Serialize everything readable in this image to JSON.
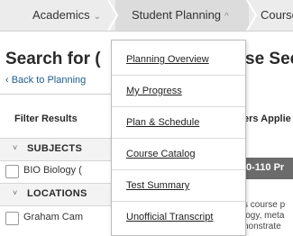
{
  "nav": {
    "tabs": [
      {
        "label": "Academics",
        "chevron": "⌄"
      },
      {
        "label": "Student Planning",
        "chevron": "^"
      },
      {
        "label": "Course"
      }
    ]
  },
  "page": {
    "heading_left": "Search for (",
    "heading_right": "se Sect",
    "back_link": "‹ Back to Planning"
  },
  "filters": {
    "title": "Filter Results",
    "sections": [
      {
        "label": "SUBJECTS",
        "caret": "˅",
        "items": [
          "BIO Biology ("
        ]
      },
      {
        "label": "LOCATIONS",
        "caret": "˅",
        "items": [
          "Graham Cam"
        ]
      }
    ]
  },
  "results": {
    "filters_applied": "ers Applie",
    "course_title": "0-110 Pr",
    "course_desc": [
      "s course p",
      "logy, meta",
      "nonstrate"
    ]
  },
  "menu": {
    "items": [
      "Planning Overview",
      "My Progress",
      "Plan & Schedule",
      "Course Catalog",
      "Test Summary",
      "Unofficial Transcript"
    ]
  },
  "colors": {
    "nav_bg": "#ececec",
    "active_tab": "#dcdcdc",
    "link": "#1d5d90",
    "course_bar": "#6b6b6b"
  }
}
